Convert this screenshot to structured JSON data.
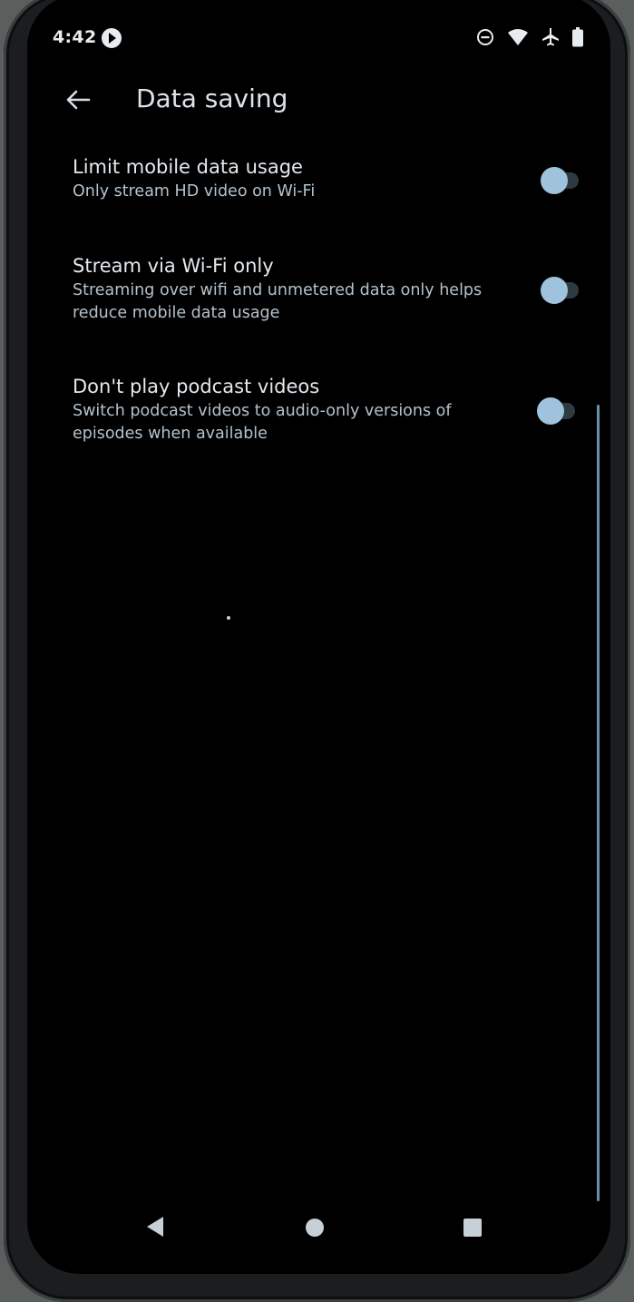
{
  "status_bar": {
    "time": "4:42"
  },
  "app_bar": {
    "title": "Data saving",
    "back_icon": "arrow-back-icon"
  },
  "settings": [
    {
      "title": "Limit mobile data usage",
      "summary": "Only stream HD video on Wi-Fi",
      "enabled": false
    },
    {
      "title": "Stream via Wi-Fi only",
      "summary": "Streaming over wifi and unmetered data only helps reduce mobile data usage",
      "enabled": false
    },
    {
      "title": "Don't play podcast videos",
      "summary": "Switch podcast videos to audio-only versions of episodes when available",
      "enabled": false
    }
  ],
  "navigation": {
    "back_icon": "triangle-back-icon",
    "home_icon": "circle-home-icon",
    "recents_icon": "square-recents-icon"
  },
  "colors": {
    "background": "#000000",
    "title_text": "#e4e9ee",
    "summary_text": "#b3c2cd",
    "toggle_thumb": "#9fc3dd",
    "toggle_track": "#2d3a42",
    "scrollbar": "#6b8fa8"
  }
}
